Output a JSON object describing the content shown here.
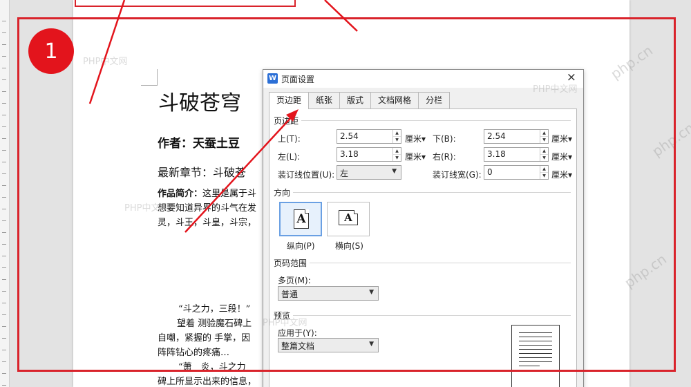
{
  "step_badge": "1",
  "watermarks": [
    "PHP中文网",
    "PHP中文网",
    "PHP中文网",
    "PHP中文网",
    "php.cn",
    "php.cn",
    "php.cn"
  ],
  "document": {
    "title": "斗破苍穹",
    "author": "作者：天蚕土豆",
    "latest_chapter": "最新章节：斗破苍",
    "intro_label": "作品简介：",
    "intro_lines": [
      "这里是属于斗",
      "想要知道异界的斗气在发",
      "灵，斗王，斗皇，斗宗，"
    ],
    "body_lines": [
      "“斗之力，三段！”",
      "望着 测验魔石碑上",
      "自嘲，紧握的 手掌，因",
      "阵阵钻心的疼痛…",
      "“萧　炎，斗之力",
      "碑上所显示出来的信息，"
    ]
  },
  "dialog": {
    "app_icon": "W",
    "title": "页面设置",
    "close": "×",
    "tabs": [
      "页边距",
      "纸张",
      "版式",
      "文档网格",
      "分栏"
    ],
    "active_tab": 0,
    "margins": {
      "section": "页边距",
      "top_label": "上(T):",
      "top_value": "2.54",
      "bottom_label": "下(B):",
      "bottom_value": "2.54",
      "left_label": "左(L):",
      "left_value": "3.18",
      "right_label": "右(R):",
      "right_value": "3.18",
      "gutter_pos_label": "装订线位置(U):",
      "gutter_pos_value": "左",
      "gutter_width_label": "装订线宽(G):",
      "gutter_width_value": "0",
      "unit": "厘米▾"
    },
    "orientation": {
      "section": "方向",
      "portrait_label": "纵向(P)",
      "landscape_label": "横向(S)",
      "glyph": "A",
      "selected": "portrait"
    },
    "page_range": {
      "section": "页码范围",
      "multi_label": "多页(M):",
      "multi_value": "普通"
    },
    "preview": {
      "section": "预览",
      "apply_label": "应用于(Y):",
      "apply_value": "整篇文档"
    }
  },
  "colors": {
    "highlight_red": "#d9232b",
    "badge_red": "#e3141c",
    "selection_blue": "#6aa0e3"
  }
}
